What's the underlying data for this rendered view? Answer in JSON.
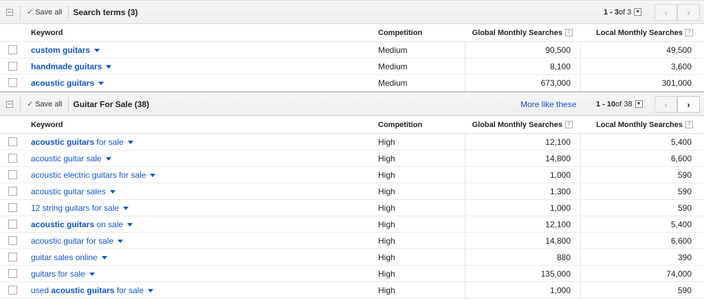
{
  "columns": {
    "keyword": "Keyword",
    "competition": "Competition",
    "global": "Global Monthly Searches",
    "local": "Local Monthly Searches",
    "help_glyph": "?"
  },
  "groups": [
    {
      "save_all": "Save all",
      "title": "Search terms (3)",
      "more_like": "",
      "pager_range": "1 - 3",
      "pager_of": " of 3",
      "rows": [
        {
          "kw_bold": "custom guitars",
          "kw_rest": "",
          "competition": "Medium",
          "global": "90,500",
          "local": "49,500"
        },
        {
          "kw_bold": "handmade guitars",
          "kw_rest": "",
          "competition": "Medium",
          "global": "8,100",
          "local": "3,600"
        },
        {
          "kw_bold": "acoustic guitars",
          "kw_rest": "",
          "competition": "Medium",
          "global": "673,000",
          "local": "301,000"
        }
      ]
    },
    {
      "save_all": "Save all",
      "title": "Guitar For Sale (38)",
      "more_like": "More like these",
      "pager_range": "1 - 10",
      "pager_of": " of 38",
      "rows": [
        {
          "kw_pre": "",
          "kw_bold": "acoustic guitars",
          "kw_rest": " for sale",
          "competition": "High",
          "global": "12,100",
          "local": "5,400"
        },
        {
          "kw_pre": "acoustic guitar sale",
          "kw_bold": "",
          "kw_rest": "",
          "competition": "High",
          "global": "14,800",
          "local": "6,600"
        },
        {
          "kw_pre": "acoustic electric guitars for sale",
          "kw_bold": "",
          "kw_rest": "",
          "competition": "High",
          "global": "1,000",
          "local": "590"
        },
        {
          "kw_pre": "acoustic guitar sales",
          "kw_bold": "",
          "kw_rest": "",
          "competition": "High",
          "global": "1,300",
          "local": "590"
        },
        {
          "kw_pre": "12 string guitars for sale",
          "kw_bold": "",
          "kw_rest": "",
          "competition": "High",
          "global": "1,000",
          "local": "590"
        },
        {
          "kw_pre": "",
          "kw_bold": "acoustic guitars",
          "kw_rest": " on sale",
          "competition": "High",
          "global": "12,100",
          "local": "5,400"
        },
        {
          "kw_pre": "acoustic guitar for sale",
          "kw_bold": "",
          "kw_rest": "",
          "competition": "High",
          "global": "14,800",
          "local": "6,600"
        },
        {
          "kw_pre": "guitar sales online",
          "kw_bold": "",
          "kw_rest": "",
          "competition": "High",
          "global": "880",
          "local": "390"
        },
        {
          "kw_pre": "guitars for sale",
          "kw_bold": "",
          "kw_rest": "",
          "competition": "High",
          "global": "135,000",
          "local": "74,000"
        },
        {
          "kw_pre": "used ",
          "kw_bold": "acoustic guitars",
          "kw_rest": " for sale",
          "competition": "High",
          "global": "1,000",
          "local": "590"
        }
      ]
    }
  ],
  "icons": {
    "check": "✓",
    "dropdown": "▼",
    "prev": "‹",
    "next": "›"
  }
}
